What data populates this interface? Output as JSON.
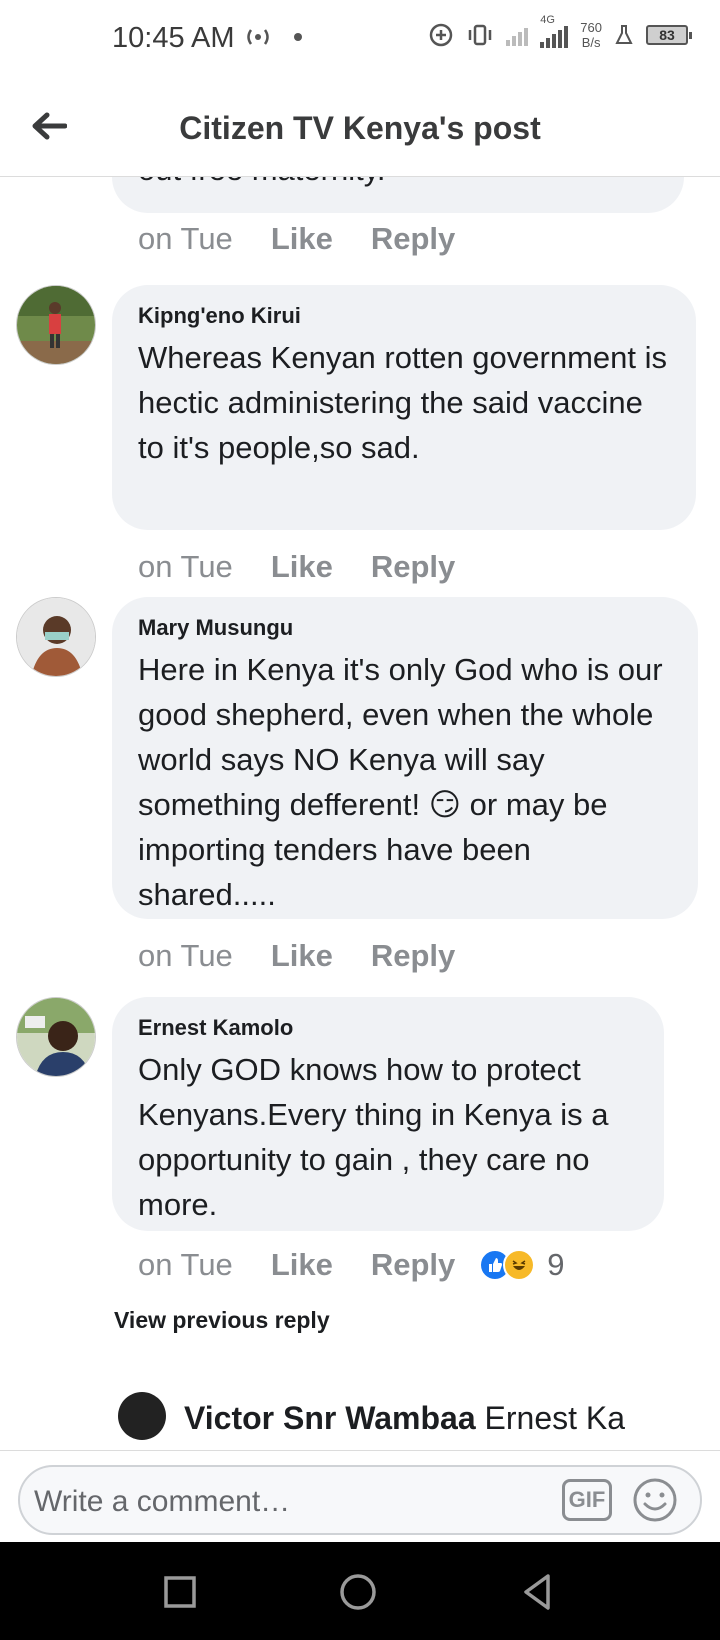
{
  "status_bar": {
    "time": "10:45 AM",
    "network_type": "4G",
    "speed_value": "760",
    "speed_unit": "B/s",
    "battery": "83"
  },
  "header": {
    "title": "Citizen TV Kenya's post",
    "back_icon": "arrow-left-icon"
  },
  "comments": [
    {
      "author": "",
      "text": "out free maternity.",
      "time": "on Tue",
      "like_label": "Like",
      "reply_label": "Reply"
    },
    {
      "author": "Kipng'eno Kirui",
      "text": "Whereas Kenyan rotten government is hectic administering the said vaccine to it's people,so sad.",
      "time": "on Tue",
      "like_label": "Like",
      "reply_label": "Reply"
    },
    {
      "author": "Mary Musungu",
      "text_before_emoji": "Here in Kenya it's only God who is our good shepherd,  even when  the whole world says NO Kenya will say something defferent!",
      "emoji": "😏",
      "text_after_emoji": "or may be importing tenders have been shared.....",
      "time": "on Tue",
      "like_label": "Like",
      "reply_label": "Reply"
    },
    {
      "author": "Ernest Kamolo",
      "text": "Only GOD knows how to protect Kenyans.Every thing in Kenya is a opportunity to gain , they care no more.",
      "time": "on Tue",
      "like_label": "Like",
      "reply_label": "Reply",
      "reaction_count": "9",
      "reaction_icons": [
        "like-icon",
        "haha-icon"
      ]
    }
  ],
  "view_previous_reply": "View previous reply",
  "partial_reply": {
    "author": "Victor Snr Wambaa",
    "text": "Ernest Ka"
  },
  "composer": {
    "placeholder": "Write a comment…",
    "gif_label": "GIF"
  },
  "colors": {
    "bubble": "#f0f2f5",
    "meta_text": "#8a8d91",
    "like_blue": "#1877f2",
    "haha_yellow": "#f7b928"
  }
}
